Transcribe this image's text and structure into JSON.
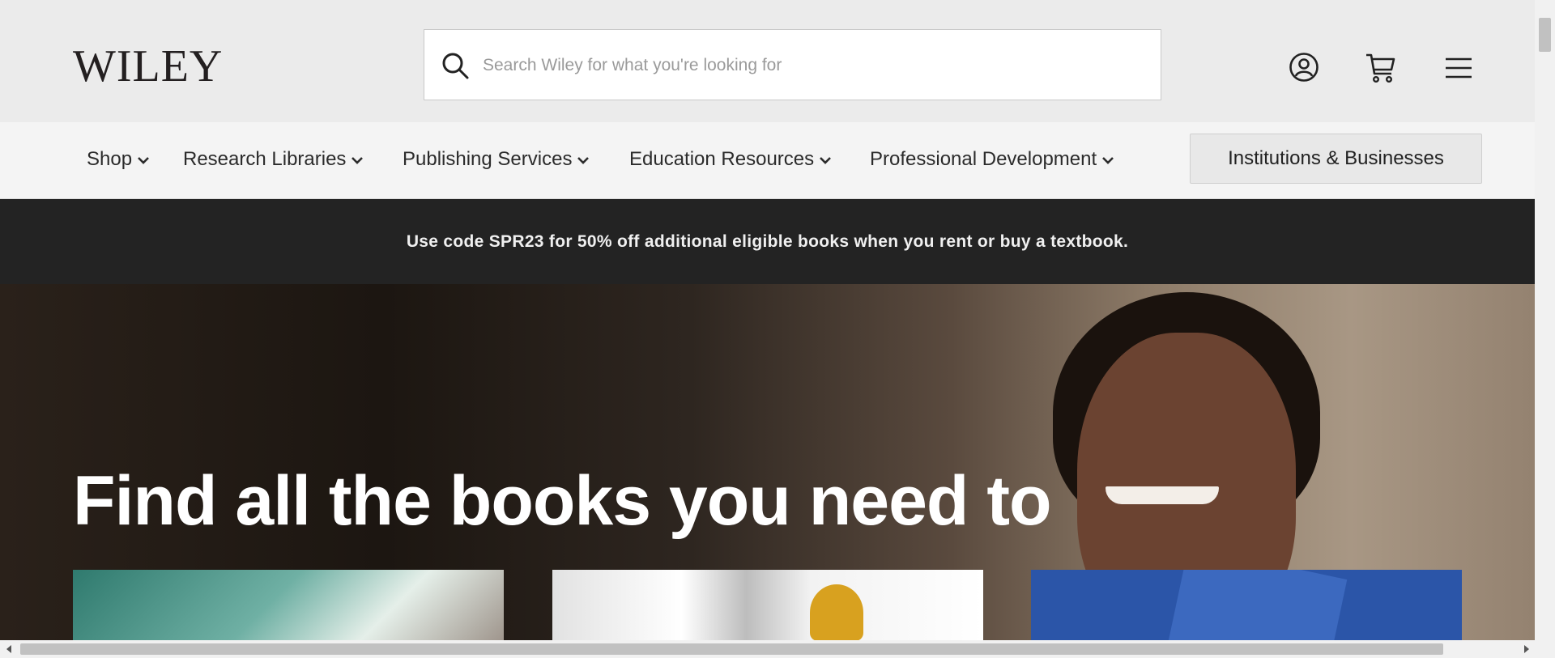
{
  "header": {
    "logo_text": "WILEY",
    "search_placeholder": "Search Wiley for what you're looking for",
    "icons": [
      "account-icon",
      "cart-icon",
      "menu-icon"
    ]
  },
  "nav": {
    "items": [
      {
        "label": "Shop"
      },
      {
        "label": "Research Libraries"
      },
      {
        "label": "Publishing Services"
      },
      {
        "label": "Education Resources"
      },
      {
        "label": "Professional Development"
      }
    ],
    "cta_label": "Institutions & Businesses"
  },
  "promo": {
    "text": "Use code SPR23 for 50% off additional eligible books when you rent or buy a textbook."
  },
  "hero": {
    "headline": "Find all the books you need to"
  },
  "colors": {
    "header_bg": "#ebebeb",
    "nav_bg": "#f4f4f4",
    "promo_bg": "#232323",
    "card_blue": "#2b55a8"
  }
}
